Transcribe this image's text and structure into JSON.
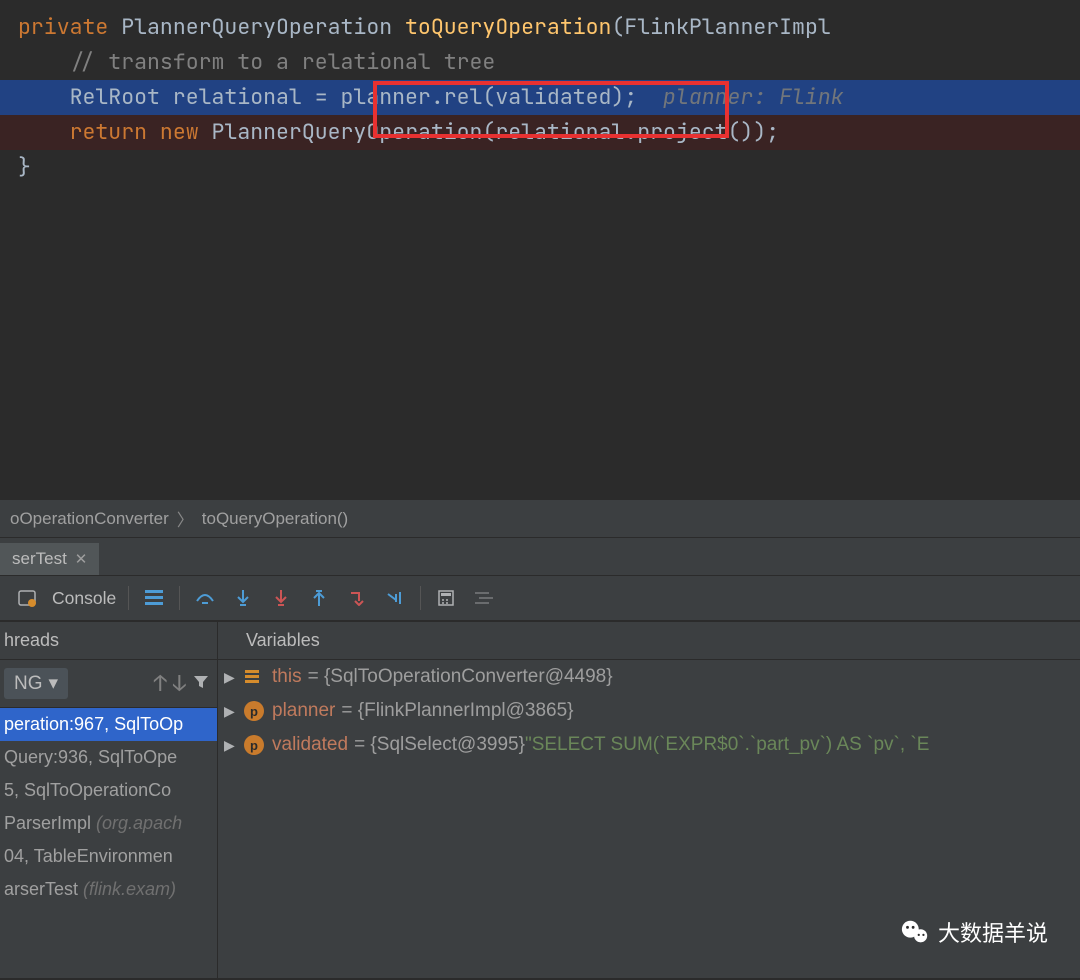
{
  "code": {
    "l1": {
      "kw": "private",
      "sp1": " ",
      "type": "PlannerQueryOperation ",
      "method": "toQueryOperation",
      "paren_open": "(",
      "arg": "FlinkPlannerImpl"
    },
    "l2": {
      "indent": "    ",
      "comment": "// transform to a relational tree"
    },
    "l3": {
      "indent": "    ",
      "text_a": "RelRoot relational = ",
      "text_b": "planner.rel(validated);",
      "sp": "  ",
      "hint": "planner: Flink"
    },
    "l4": {
      "indent": "    ",
      "kw_return": "return",
      "sp": " ",
      "kw_new": "new",
      "sp2": " ",
      "text": "PlannerQueryOperation(relational.project());"
    },
    "l5": {
      "brace": "}"
    }
  },
  "breadcrumbs": {
    "a": "oOperationConverter",
    "b": "toQueryOperation()"
  },
  "tab": {
    "label": "serTest",
    "close": "✕"
  },
  "toolbar": {
    "console": "Console"
  },
  "panes": {
    "threads": "hreads",
    "variables": "Variables"
  },
  "threads_sel": "NG",
  "frames": [
    {
      "text": "peration:967, SqlToOp",
      "sel": true
    },
    {
      "text": "Query:936, SqlToOpe"
    },
    {
      "text": "5, SqlToOperationCo"
    },
    {
      "text": "ParserImpl ",
      "faded": "(org.apach"
    },
    {
      "text": "04, TableEnvironmen"
    },
    {
      "text": "arserTest ",
      "faded": "(flink.exam)"
    }
  ],
  "vars": [
    {
      "badge": "group",
      "name": "this",
      "val": " = {SqlToOperationConverter@4498}"
    },
    {
      "badge": "p",
      "name": "planner",
      "val": " = {FlinkPlannerImpl@3865}"
    },
    {
      "badge": "p",
      "name": "validated",
      "val": " = {SqlSelect@3995} ",
      "str": "\"SELECT SUM(`EXPR$0`.`part_pv`) AS `pv`, `E"
    }
  ],
  "watermark": "大数据羊说"
}
